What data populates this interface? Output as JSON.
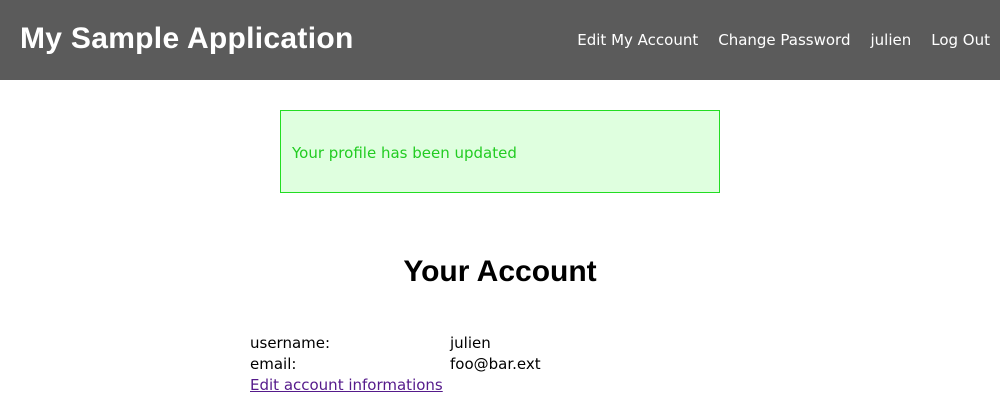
{
  "header": {
    "app_title": "My Sample Application",
    "nav": [
      {
        "label": "Edit My Account"
      },
      {
        "label": "Change Password"
      },
      {
        "label": "julien"
      },
      {
        "label": "Log Out"
      }
    ]
  },
  "flash": {
    "message": "Your profile has been updated"
  },
  "main": {
    "title": "Your Account",
    "fields": [
      {
        "label": "username:",
        "value": "julien"
      },
      {
        "label": "email:",
        "value": "foo@bar.ext"
      }
    ],
    "edit_link": "Edit account informations"
  },
  "colors": {
    "header_bg": "#5b5b5b",
    "flash_border": "#22dd22",
    "flash_bg": "#dfffdf",
    "flash_text": "#22cc22",
    "visited_link": "#551a8b"
  }
}
